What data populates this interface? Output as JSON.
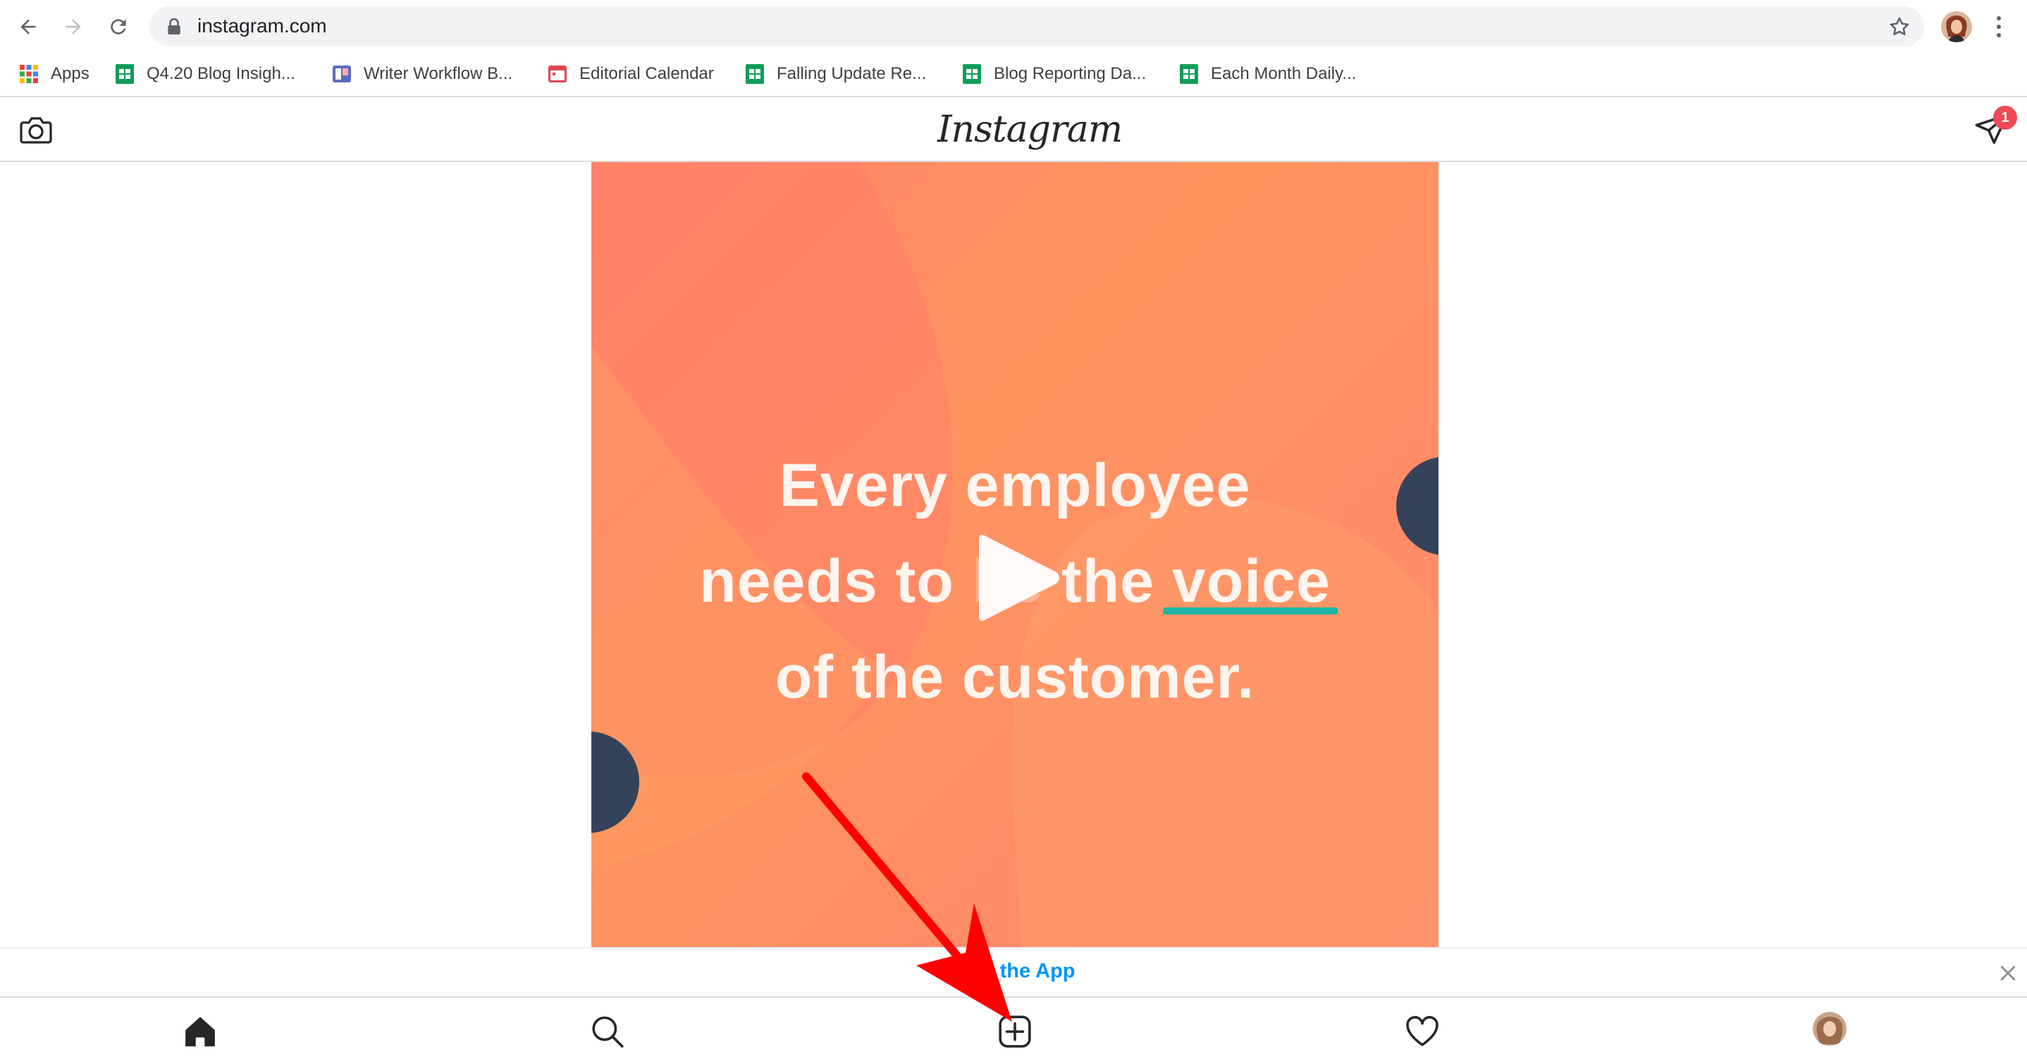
{
  "browser": {
    "url": "instagram.com",
    "nav": {
      "back": "back-arrow-icon",
      "forward": "forward-arrow-icon",
      "reload": "reload-icon"
    },
    "bookmarks": [
      {
        "label": "Apps",
        "icon": "apps-grid-icon"
      },
      {
        "label": "Q4.20 Blog Insigh...",
        "icon": "google-sheets-icon"
      },
      {
        "label": "Writer Workflow B...",
        "icon": "board-icon"
      },
      {
        "label": "Editorial Calendar",
        "icon": "calendar-icon"
      },
      {
        "label": "Falling Update Re...",
        "icon": "google-sheets-icon"
      },
      {
        "label": "Blog Reporting Da...",
        "icon": "google-sheets-icon"
      },
      {
        "label": "Each Month Daily...",
        "icon": "google-sheets-icon"
      }
    ]
  },
  "instagram": {
    "logo": "Instagram",
    "direct_badge_count": "1",
    "post": {
      "lines": [
        "Every employee",
        "needs to be the voice",
        "of the customer."
      ],
      "line2_parts": {
        "before": "needs to ",
        "be": "be",
        "the": " the ",
        "voice": "voice"
      }
    },
    "banner": {
      "text": "Open the App",
      "visible_text": "e the App"
    },
    "tabs": [
      "home-icon",
      "search-icon",
      "new-post-icon",
      "activity-heart-icon",
      "profile-avatar"
    ]
  },
  "colors": {
    "accent_blue": "#0095f6",
    "badge_red": "#ed4956",
    "post_orange": "#ff8a66",
    "teal_underline": "#1db5a3",
    "navy_circle": "#34435a",
    "annotation_red": "#ff0000"
  }
}
